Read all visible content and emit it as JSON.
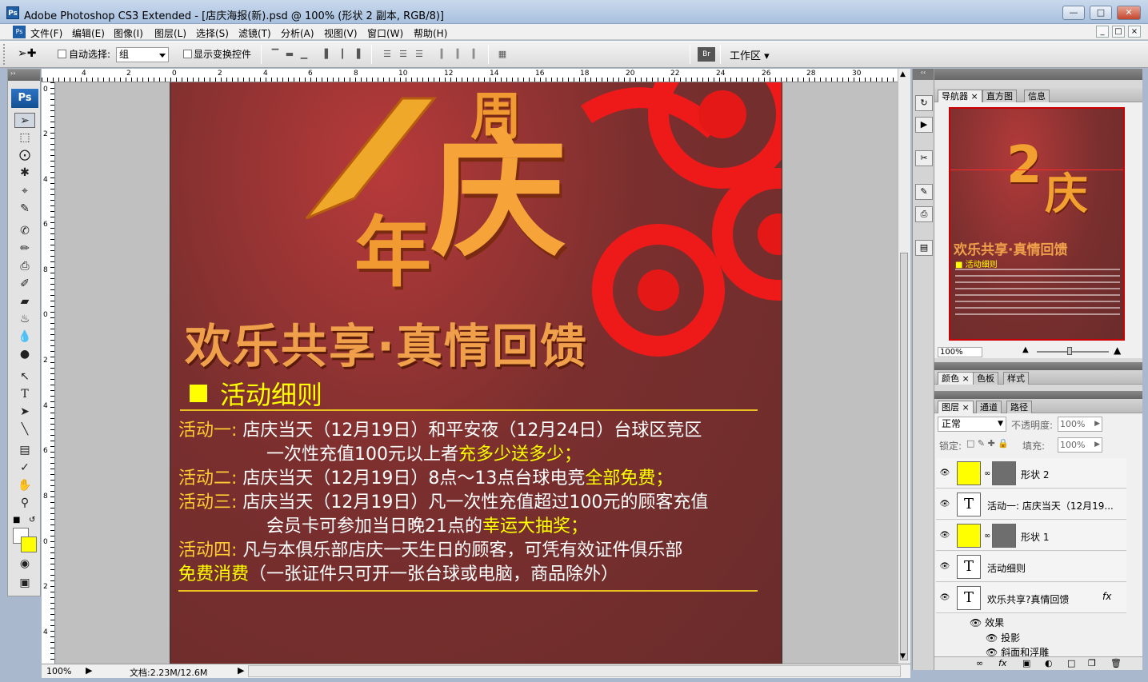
{
  "window": {
    "title": "Adobe Photoshop CS3 Extended - [店庆海报(新).psd @ 100% (形状 2 副本, RGB/8)]",
    "ps_badge": "Ps"
  },
  "menu": [
    "文件(F)",
    "编辑(E)",
    "图像(I)",
    "图层(L)",
    "选择(S)",
    "滤镜(T)",
    "分析(A)",
    "视图(V)",
    "窗口(W)",
    "帮助(H)"
  ],
  "options": {
    "auto_select_label": "自动选择:",
    "auto_select_value": "组",
    "show_transform_label": "显示变换控件",
    "workspace": "工作区"
  },
  "ruler_top": [
    "4",
    "2",
    "0",
    "2",
    "4",
    "6",
    "8",
    "10",
    "12",
    "14",
    "16",
    "18",
    "20",
    "22",
    "24",
    "26",
    "28",
    "30"
  ],
  "ruler_left": [
    "0",
    "2",
    "4",
    "6",
    "8",
    "0",
    "2",
    "4",
    "6",
    "8",
    "0",
    "2",
    "4"
  ],
  "toolbox": {
    "logo": "Ps"
  },
  "poster": {
    "big_num": "2",
    "zhou": "周",
    "nian": "年",
    "qing": "庆",
    "slogan": "欢乐共享·真情回馈",
    "rules_title": "活动细则",
    "lines": [
      {
        "lbl": "活动一:",
        "text": "店庆当天（12月19日）和平安夜（12月24日）台球区竞区"
      },
      {
        "lbl": "",
        "text": "一次性充值100元以上者",
        "hl": "充多少送多少；"
      },
      {
        "lbl": "活动二:",
        "text": "店庆当天（12月19日）8点～13点台球电竞",
        "hl": "全部免费；"
      },
      {
        "lbl": "活动三:",
        "text": "店庆当天（12月19日）凡一次性充值超过100元的顾客充值"
      },
      {
        "lbl": "",
        "text": "会员卡可参加当日晚21点的",
        "hl": "幸运大抽奖；"
      },
      {
        "lbl": "活动四:",
        "text": "凡与本俱乐部店庆一天生日的顾客，可凭有效证件俱乐部"
      },
      {
        "lbl": "免费消费",
        "text": "（一张证件只可开一张台球或电脑，商品除外）"
      }
    ]
  },
  "status": {
    "zoom": "100%",
    "doc": "文档:2.23M/12.6M"
  },
  "navigator": {
    "tabs": [
      "导航器",
      "直方图",
      "信息"
    ],
    "zoom": "100%",
    "thumb_slogan": "欢乐共享·真情回馈",
    "thumb_rules": "活动细则"
  },
  "color_panel": {
    "tabs": [
      "颜色",
      "色板",
      "样式"
    ]
  },
  "layers_panel": {
    "tabs": [
      "图层",
      "通道",
      "路径"
    ],
    "blend": "正常",
    "opacity_label": "不透明度:",
    "opacity": "100%",
    "lock_label": "锁定:",
    "fill_label": "填充:",
    "fill": "100%",
    "layers": [
      {
        "name": "形状 2",
        "kind": "shape"
      },
      {
        "name": "活动一: 店庆当天（12月19...",
        "kind": "text"
      },
      {
        "name": "形状 1",
        "kind": "shape"
      },
      {
        "name": "活动细则",
        "kind": "text"
      },
      {
        "name": "欢乐共享?真情回馈",
        "kind": "text"
      }
    ],
    "effects_label": "效果",
    "effect_1": "投影",
    "effect_2": "斜面和浮雕"
  },
  "colors": {
    "poster_bg": "#7a2f2e",
    "highlight": "#ffff00",
    "gold": "#f3a93a",
    "red": "#e31b1b"
  }
}
